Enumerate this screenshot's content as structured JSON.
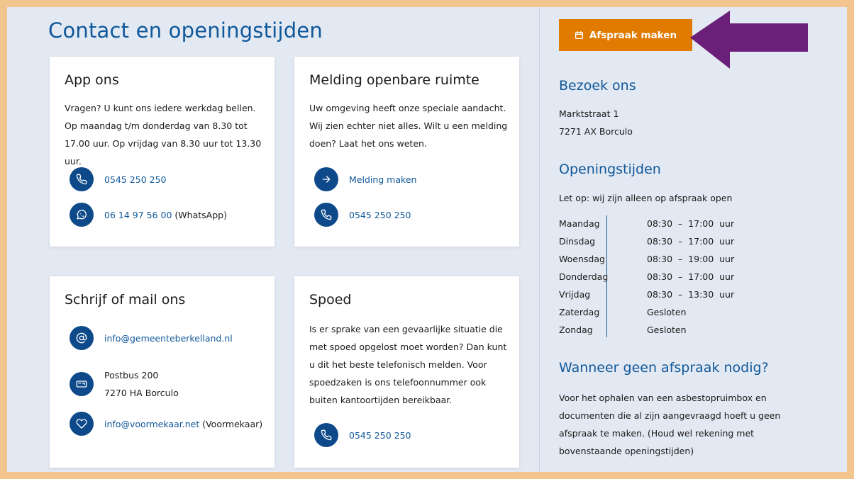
{
  "page": {
    "title": "Contact en openingstijden"
  },
  "cards": {
    "app": {
      "title": "App ons",
      "text": "Vragen? U kunt ons iedere werkdag bellen. Op maandag t/m donderdag van 8.30 tot 17.00 uur. Op vrijdag van 8.30 uur tot 13.30 uur.",
      "phone": "0545 250 250",
      "whatsapp_number": "06 14 97 56 00",
      "whatsapp_suffix": " (WhatsApp)"
    },
    "melding": {
      "title": "Melding openbare ruimte",
      "text": "Uw omgeving heeft onze speciale aandacht. Wij zien echter niet alles. Wilt u een melding doen? Laat het ons weten.",
      "link": "Melding maken",
      "phone": "0545 250 250"
    },
    "mail": {
      "title": "Schrijf of mail ons",
      "email": "info@gemeenteberkelland.nl",
      "postbus": "Postbus 200",
      "postcode": "7270 HA Borculo",
      "email2": "info@voormekaar.net",
      "email2_suffix": " (Voormekaar)"
    },
    "spoed": {
      "title": "Spoed",
      "text": "Is er sprake van een gevaarlijke situatie die met spoed opgelost moet worden? Dan kunt u dit het beste telefonisch melden. Voor spoedzaken is ons telefoonnummer ook buiten kantoortijden bereikbaar.",
      "phone": "0545 250 250"
    }
  },
  "sidebar": {
    "button_label": "Afspraak maken",
    "visit_title": "Bezoek ons",
    "address_line1": "Marktstraat 1",
    "address_line2": "7271 AX Borculo",
    "hours_title": "Openingstijden",
    "hours_note": "Let op: wij zijn alleen op afspraak open",
    "hours": [
      {
        "day": "Maandag",
        "time": "08:30  –  17:00  uur"
      },
      {
        "day": "Dinsdag",
        "time": "08:30  –  17:00  uur"
      },
      {
        "day": "Woensdag",
        "time": "08:30  –  19:00  uur"
      },
      {
        "day": "Donderdag",
        "time": "08:30  –  17:00  uur"
      },
      {
        "day": "Vrijdag",
        "time": "08:30  –  13:30  uur"
      },
      {
        "day": "Zaterdag",
        "time": "Gesloten"
      },
      {
        "day": "Zondag",
        "time": "Gesloten"
      }
    ],
    "noappt_title": "Wanneer geen afspraak nodig?",
    "noappt_text": "Voor het ophalen van een asbestopruimbox en documenten die al zijn aangevraagd hoeft u geen afspraak te maken. (Houd wel rekening met bovenstaande openingstijden)"
  },
  "colors": {
    "frame": "#f2c58e",
    "background": "#e3e9f2",
    "primary": "#10589a",
    "icon_circle": "#0e4a8a",
    "button": "#e07a00",
    "arrow": "#6a1f78"
  },
  "icons": [
    "phone-icon",
    "whatsapp-icon",
    "arrow-right-icon",
    "at-icon",
    "mailbox-icon",
    "heart-icon",
    "calendar-icon",
    "pointer-arrow"
  ]
}
